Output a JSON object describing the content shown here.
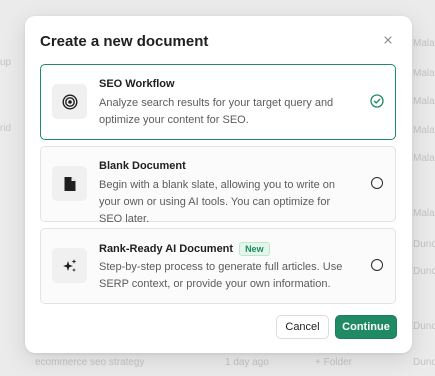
{
  "background": {
    "left_fragments": [
      "up",
      "rid"
    ],
    "right_fragments": [
      "Malac",
      "Malac",
      "Malac",
      "Malac",
      "Malac",
      "Malac",
      "Duncs",
      "Duncs",
      "Duncs",
      "Duncs"
    ],
    "bottom_row": {
      "name": "ecommerce seo strategy",
      "time": "1 day ago",
      "folder": "+ Folder"
    }
  },
  "modal": {
    "title": "Create a new document",
    "close_icon": "close-icon",
    "options": [
      {
        "title": "SEO Workflow",
        "description": "Analyze search results for your target query and optimize your content for SEO.",
        "icon": "target-icon",
        "selected": true
      },
      {
        "title": "Blank Document",
        "description": "Begin with a blank slate, allowing you to write on your own or using AI tools. You can optimize for SEO later.",
        "icon": "document-icon",
        "selected": false
      },
      {
        "title": "Rank-Ready AI Document",
        "badge": "New",
        "description": "Step-by-step process to generate full articles. Use SERP context, or provide your own information.",
        "icon": "sparkle-icon",
        "selected": false
      }
    ],
    "buttons": {
      "cancel": "Cancel",
      "continue": "Continue"
    }
  },
  "colors": {
    "accent": "#1f8a63",
    "badge_bg": "#e4f5ec"
  }
}
